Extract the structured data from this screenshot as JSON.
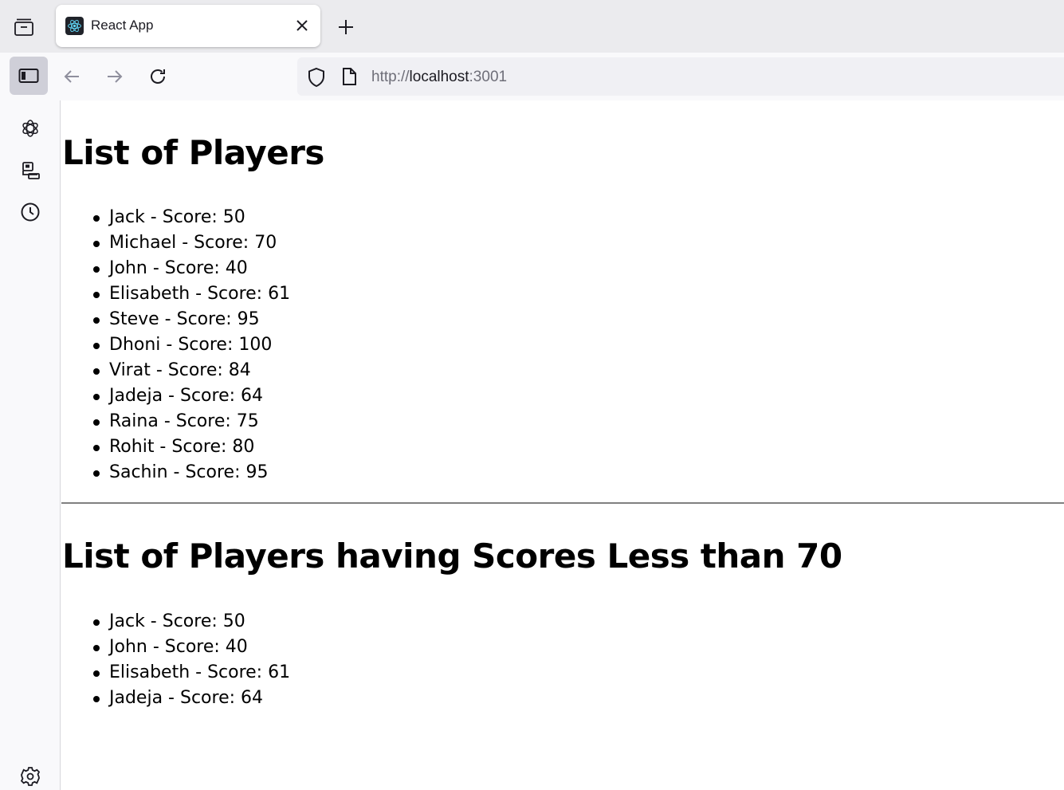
{
  "browser": {
    "tab": {
      "title": "React App",
      "favicon": "react-icon"
    },
    "url": {
      "scheme": "http://",
      "host": "localhost",
      "port": ":3001"
    }
  },
  "page": {
    "heading_all": "List of Players",
    "players": [
      "Jack - Score: 50",
      "Michael - Score: 70",
      "John - Score: 40",
      "Elisabeth - Score: 61",
      "Steve - Score: 95",
      "Dhoni - Score: 100",
      "Virat - Score: 84",
      "Jadeja - Score: 64",
      "Raina - Score: 75",
      "Rohit - Score: 80",
      "Sachin - Score: 95"
    ],
    "heading_filtered": "List of Players having Scores Less than 70",
    "filtered_players": [
      "Jack - Score: 50",
      "John - Score: 40",
      "Elisabeth - Score: 61",
      "Jadeja - Score: 64"
    ]
  },
  "colors": {
    "tabstrip_bg": "#ebebee",
    "toolbar_bg": "#f9f9fb",
    "react_brand": "#61dafb"
  }
}
